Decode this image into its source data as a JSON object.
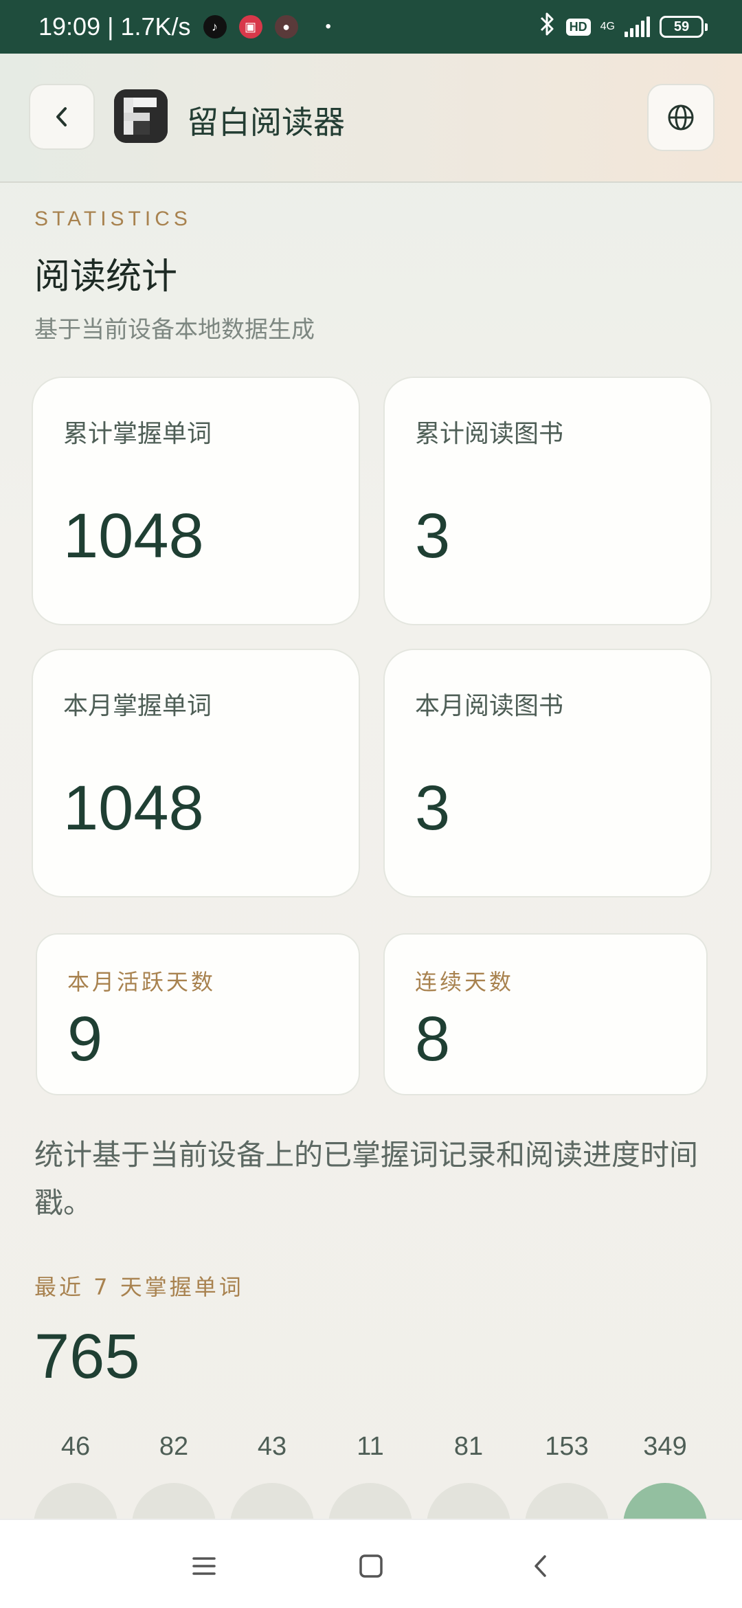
{
  "status_bar": {
    "time_speed": "19:09 | 1.7K/s",
    "hd": "HD",
    "network": "4G",
    "battery": "59",
    "icons": [
      "tiktok-icon",
      "news-app-icon",
      "game-app-icon",
      "bluetooth-icon",
      "signal-icon",
      "battery-icon"
    ]
  },
  "header": {
    "title": "留白阅读器",
    "back_icon": "chevron-left-icon",
    "logo": "app-logo-f",
    "globe_icon": "globe-icon"
  },
  "section": {
    "overline": "STATISTICS",
    "title": "阅读统计",
    "subtitle": "基于当前设备本地数据生成"
  },
  "cards": [
    {
      "label": "累计掌握单词",
      "value": "1048"
    },
    {
      "label": "累计阅读图书",
      "value": "3"
    },
    {
      "label": "本月掌握单词",
      "value": "1048"
    },
    {
      "label": "本月阅读图书",
      "value": "3"
    }
  ],
  "small_cards": [
    {
      "label": "本月活跃天数",
      "value": "9"
    },
    {
      "label": "连续天数",
      "value": "8"
    }
  ],
  "note": "统计基于当前设备上的已掌握词记录和阅读进度时间戳。",
  "recent": {
    "label": "最近 7 天掌握单词",
    "total": "765",
    "days": [
      "46",
      "82",
      "43",
      "11",
      "81",
      "153",
      "349"
    ]
  },
  "colors": {
    "status_bar": "#1f4d3d",
    "accent_gold": "#a8824f",
    "value_green": "#1f3f33",
    "active_bubble": "#93bfa0"
  }
}
